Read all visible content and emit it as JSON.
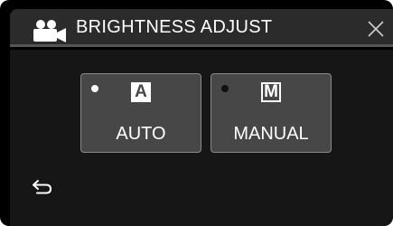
{
  "header": {
    "title": "BRIGHTNESS ADJUST",
    "mode_icon": "movie-camera-icon",
    "close_icon": "close-icon"
  },
  "options": [
    {
      "glyph": "A",
      "label": "AUTO",
      "selected": true,
      "icon": "auto-mode-icon"
    },
    {
      "glyph": "M",
      "label": "MANUAL",
      "selected": false,
      "icon": "manual-mode-icon"
    }
  ],
  "footer": {
    "back_icon": "return-arrow-icon"
  },
  "colors": {
    "background": "#000000",
    "header_bg": "#2b2b2b",
    "button_bg": "#474747",
    "text": "#ffffff"
  }
}
